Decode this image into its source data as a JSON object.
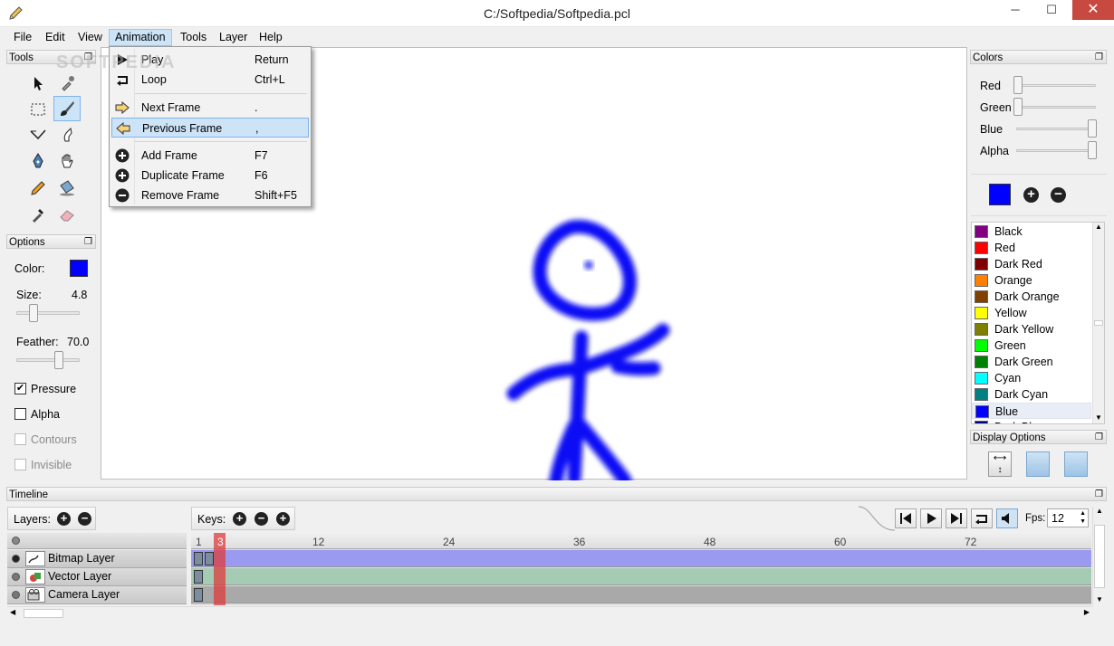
{
  "window": {
    "title": "C:/Softpedia/Softpedia.pcl",
    "minimize": "─",
    "maximize": "☐",
    "close": "✕"
  },
  "menubar": [
    "File",
    "Edit",
    "View",
    "Animation",
    "Tools",
    "Layer",
    "Help"
  ],
  "animation_menu": {
    "items": [
      {
        "label": "Play",
        "shortcut": "Return",
        "icon": "play-icon"
      },
      {
        "label": "Loop",
        "shortcut": "Ctrl+L",
        "icon": "loop-icon"
      },
      {
        "label": "Next Frame",
        "shortcut": ".",
        "icon": "arrow-right-icon"
      },
      {
        "label": "Previous Frame",
        "shortcut": ",",
        "icon": "arrow-left-icon",
        "highlighted": true
      },
      {
        "label": "Add Frame",
        "shortcut": "F7",
        "icon": "plus-circle-icon"
      },
      {
        "label": "Duplicate Frame",
        "shortcut": "F6",
        "icon": "duplicate-icon"
      },
      {
        "label": "Remove Frame",
        "shortcut": "Shift+F5",
        "icon": "minus-circle-icon"
      }
    ]
  },
  "tools_panel": {
    "title": "Tools",
    "tools": [
      "select-arrow-icon",
      "eyedropper-icon",
      "rectangle-select-icon",
      "brush-icon",
      "polyline-icon",
      "smudge-icon",
      "pen-icon",
      "hand-icon",
      "pencil-icon",
      "bucket-icon",
      "color-picker-icon",
      "eraser-icon"
    ],
    "selected": "brush-icon"
  },
  "options_panel": {
    "title": "Options",
    "color_label": "Color:",
    "color_value": "#0000ff",
    "size_label": "Size:",
    "size_value": "4.8",
    "size_fraction": 0.24,
    "feather_label": "Feather:",
    "feather_value": "70.0",
    "feather_fraction": 0.7,
    "pressure_label": "Pressure",
    "pressure_checked": true,
    "alpha_label": "Alpha",
    "alpha_checked": false,
    "contours_label": "Contours",
    "invisible_label": "Invisible"
  },
  "colors_panel": {
    "title": "Colors",
    "sliders": [
      {
        "label": "Red",
        "fraction": 0.0
      },
      {
        "label": "Green",
        "fraction": 0.0
      },
      {
        "label": "Blue",
        "fraction": 1.0
      },
      {
        "label": "Alpha",
        "fraction": 1.0
      }
    ],
    "current_color": "#0000ff",
    "palette": [
      {
        "name": "Black",
        "color": "#800080"
      },
      {
        "name": "Red",
        "color": "#ff0000"
      },
      {
        "name": "Dark Red",
        "color": "#800000"
      },
      {
        "name": "Orange",
        "color": "#ff8000"
      },
      {
        "name": "Dark Orange",
        "color": "#804000"
      },
      {
        "name": "Yellow",
        "color": "#ffff00"
      },
      {
        "name": "Dark Yellow",
        "color": "#808000"
      },
      {
        "name": "Green",
        "color": "#00ff00"
      },
      {
        "name": "Dark Green",
        "color": "#008000"
      },
      {
        "name": "Cyan",
        "color": "#00ffff"
      },
      {
        "name": "Dark Cyan",
        "color": "#008080"
      },
      {
        "name": "Blue",
        "color": "#0000ff",
        "selected": true
      },
      {
        "name": "Dark Blue",
        "color": "#000080"
      }
    ]
  },
  "display_options": {
    "title": "Display Options"
  },
  "timeline": {
    "title": "Timeline",
    "layers_label": "Layers:",
    "keys_label": "Keys:",
    "fps_label": "Fps:",
    "fps_value": "12",
    "ruler": [
      "1",
      "3",
      "12",
      "24",
      "36",
      "48",
      "60",
      "72"
    ],
    "current_frame": 3,
    "layers": [
      {
        "name": "Bitmap Layer",
        "visible": true,
        "icon": "bitmap-layer-icon",
        "track_color": "#9a9af0"
      },
      {
        "name": "Vector Layer",
        "visible": false,
        "icon": "vector-layer-icon",
        "track_color": "#a6cbb5"
      },
      {
        "name": "Camera Layer",
        "visible": false,
        "icon": "camera-layer-icon",
        "track_color": "#a9a9a9"
      }
    ]
  },
  "watermark": "SOFTPEDIA"
}
